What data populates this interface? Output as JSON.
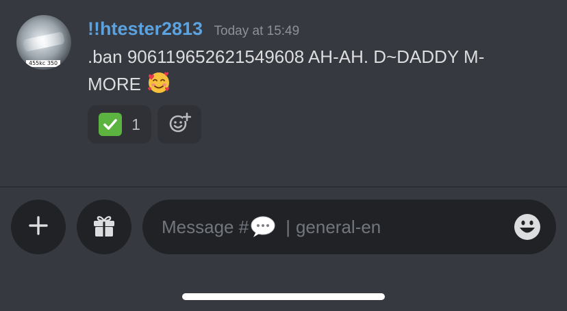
{
  "message": {
    "username": "!!htester2813",
    "timestamp": "Today at 15:49",
    "text_line1": ".ban 906119652621549608 AH-AH. D~DADDY M-",
    "text_line2": "MORE",
    "inline_emoji": "smiling-face-with-hearts-icon",
    "avatar_tag": "455kc 350"
  },
  "reactions": [
    {
      "emoji": "white-check-mark-icon",
      "count": "1"
    },
    {
      "emoji": "add-reaction-icon"
    }
  ],
  "composer": {
    "placeholder_prefix": "Message #",
    "placeholder_channel": "general-en",
    "separator": "|",
    "placeholder_emoji": "speech-balloon-icon"
  },
  "colors": {
    "background": "#36393f",
    "input_background": "#202225",
    "username": "#5aa3e0",
    "timestamp": "#8e9297",
    "text": "#dcddde",
    "check_green": "#5db33f"
  }
}
